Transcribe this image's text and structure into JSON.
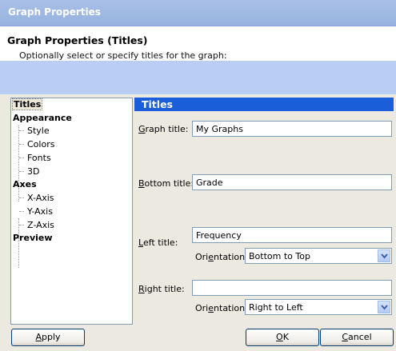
{
  "window": {
    "title": "Graph Properties"
  },
  "header": {
    "title": "Graph Properties (Titles)",
    "subtitle": "Optionally select or specify titles for the graph:"
  },
  "tree": {
    "items": [
      {
        "label": "Titles",
        "level": 0,
        "selected": true
      },
      {
        "label": "Appearance",
        "level": 0
      },
      {
        "label": "Style",
        "level": 1
      },
      {
        "label": "Colors",
        "level": 1
      },
      {
        "label": "Fonts",
        "level": 1
      },
      {
        "label": "3D",
        "level": 1
      },
      {
        "label": "Axes",
        "level": 0
      },
      {
        "label": "X-Axis",
        "level": 1
      },
      {
        "label": "Y-Axis",
        "level": 1
      },
      {
        "label": "Z-Axis",
        "level": 1
      },
      {
        "label": "Preview",
        "level": 0
      }
    ]
  },
  "panel": {
    "heading": "Titles",
    "graph_title": {
      "label_pre": "",
      "label_u": "G",
      "label_post": "raph title:",
      "value": "My Graphs"
    },
    "bottom_title": {
      "label_pre": "",
      "label_u": "B",
      "label_post": "ottom title:",
      "value": "Grade"
    },
    "left_title": {
      "label_pre": "",
      "label_u": "L",
      "label_post": "eft title:",
      "value": "Frequency",
      "orientation": {
        "label_pre": "Ori",
        "label_u": "e",
        "label_post": "ntation:",
        "value": "Bottom to Top"
      }
    },
    "right_title": {
      "label_pre": "",
      "label_u": "R",
      "label_post": "ight title:",
      "value": "",
      "orientation": {
        "label_pre": "Ori",
        "label_u": "e",
        "label_post": "ntation:",
        "value": "Right to Left"
      }
    }
  },
  "buttons": {
    "apply": {
      "pre": "",
      "u": "A",
      "post": "pply"
    },
    "ok": {
      "pre": "",
      "u": "O",
      "post": "K"
    },
    "cancel": {
      "pre": "",
      "u": "C",
      "post": "ancel"
    }
  },
  "icons": {
    "dropdown": "chevron-down-icon"
  },
  "colors": {
    "panel_heading_bg": "#1a5ed9",
    "header_band": "#b9cef2",
    "dialog_bg": "#ebe9e0"
  }
}
